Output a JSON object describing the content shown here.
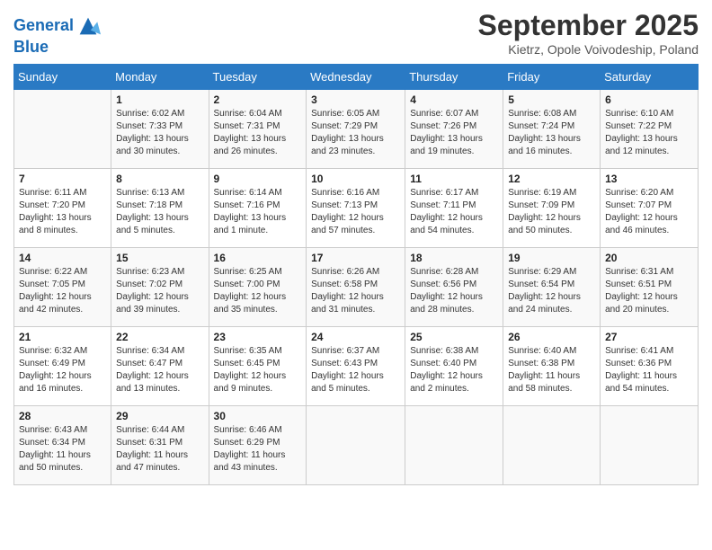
{
  "header": {
    "logo_line1": "General",
    "logo_line2": "Blue",
    "month": "September 2025",
    "location": "Kietrz, Opole Voivodeship, Poland"
  },
  "days_of_week": [
    "Sunday",
    "Monday",
    "Tuesday",
    "Wednesday",
    "Thursday",
    "Friday",
    "Saturday"
  ],
  "weeks": [
    [
      {
        "day": "",
        "sunrise": "",
        "sunset": "",
        "daylight": ""
      },
      {
        "day": "1",
        "sunrise": "Sunrise: 6:02 AM",
        "sunset": "Sunset: 7:33 PM",
        "daylight": "Daylight: 13 hours and 30 minutes."
      },
      {
        "day": "2",
        "sunrise": "Sunrise: 6:04 AM",
        "sunset": "Sunset: 7:31 PM",
        "daylight": "Daylight: 13 hours and 26 minutes."
      },
      {
        "day": "3",
        "sunrise": "Sunrise: 6:05 AM",
        "sunset": "Sunset: 7:29 PM",
        "daylight": "Daylight: 13 hours and 23 minutes."
      },
      {
        "day": "4",
        "sunrise": "Sunrise: 6:07 AM",
        "sunset": "Sunset: 7:26 PM",
        "daylight": "Daylight: 13 hours and 19 minutes."
      },
      {
        "day": "5",
        "sunrise": "Sunrise: 6:08 AM",
        "sunset": "Sunset: 7:24 PM",
        "daylight": "Daylight: 13 hours and 16 minutes."
      },
      {
        "day": "6",
        "sunrise": "Sunrise: 6:10 AM",
        "sunset": "Sunset: 7:22 PM",
        "daylight": "Daylight: 13 hours and 12 minutes."
      }
    ],
    [
      {
        "day": "7",
        "sunrise": "Sunrise: 6:11 AM",
        "sunset": "Sunset: 7:20 PM",
        "daylight": "Daylight: 13 hours and 8 minutes."
      },
      {
        "day": "8",
        "sunrise": "Sunrise: 6:13 AM",
        "sunset": "Sunset: 7:18 PM",
        "daylight": "Daylight: 13 hours and 5 minutes."
      },
      {
        "day": "9",
        "sunrise": "Sunrise: 6:14 AM",
        "sunset": "Sunset: 7:16 PM",
        "daylight": "Daylight: 13 hours and 1 minute."
      },
      {
        "day": "10",
        "sunrise": "Sunrise: 6:16 AM",
        "sunset": "Sunset: 7:13 PM",
        "daylight": "Daylight: 12 hours and 57 minutes."
      },
      {
        "day": "11",
        "sunrise": "Sunrise: 6:17 AM",
        "sunset": "Sunset: 7:11 PM",
        "daylight": "Daylight: 12 hours and 54 minutes."
      },
      {
        "day": "12",
        "sunrise": "Sunrise: 6:19 AM",
        "sunset": "Sunset: 7:09 PM",
        "daylight": "Daylight: 12 hours and 50 minutes."
      },
      {
        "day": "13",
        "sunrise": "Sunrise: 6:20 AM",
        "sunset": "Sunset: 7:07 PM",
        "daylight": "Daylight: 12 hours and 46 minutes."
      }
    ],
    [
      {
        "day": "14",
        "sunrise": "Sunrise: 6:22 AM",
        "sunset": "Sunset: 7:05 PM",
        "daylight": "Daylight: 12 hours and 42 minutes."
      },
      {
        "day": "15",
        "sunrise": "Sunrise: 6:23 AM",
        "sunset": "Sunset: 7:02 PM",
        "daylight": "Daylight: 12 hours and 39 minutes."
      },
      {
        "day": "16",
        "sunrise": "Sunrise: 6:25 AM",
        "sunset": "Sunset: 7:00 PM",
        "daylight": "Daylight: 12 hours and 35 minutes."
      },
      {
        "day": "17",
        "sunrise": "Sunrise: 6:26 AM",
        "sunset": "Sunset: 6:58 PM",
        "daylight": "Daylight: 12 hours and 31 minutes."
      },
      {
        "day": "18",
        "sunrise": "Sunrise: 6:28 AM",
        "sunset": "Sunset: 6:56 PM",
        "daylight": "Daylight: 12 hours and 28 minutes."
      },
      {
        "day": "19",
        "sunrise": "Sunrise: 6:29 AM",
        "sunset": "Sunset: 6:54 PM",
        "daylight": "Daylight: 12 hours and 24 minutes."
      },
      {
        "day": "20",
        "sunrise": "Sunrise: 6:31 AM",
        "sunset": "Sunset: 6:51 PM",
        "daylight": "Daylight: 12 hours and 20 minutes."
      }
    ],
    [
      {
        "day": "21",
        "sunrise": "Sunrise: 6:32 AM",
        "sunset": "Sunset: 6:49 PM",
        "daylight": "Daylight: 12 hours and 16 minutes."
      },
      {
        "day": "22",
        "sunrise": "Sunrise: 6:34 AM",
        "sunset": "Sunset: 6:47 PM",
        "daylight": "Daylight: 12 hours and 13 minutes."
      },
      {
        "day": "23",
        "sunrise": "Sunrise: 6:35 AM",
        "sunset": "Sunset: 6:45 PM",
        "daylight": "Daylight: 12 hours and 9 minutes."
      },
      {
        "day": "24",
        "sunrise": "Sunrise: 6:37 AM",
        "sunset": "Sunset: 6:43 PM",
        "daylight": "Daylight: 12 hours and 5 minutes."
      },
      {
        "day": "25",
        "sunrise": "Sunrise: 6:38 AM",
        "sunset": "Sunset: 6:40 PM",
        "daylight": "Daylight: 12 hours and 2 minutes."
      },
      {
        "day": "26",
        "sunrise": "Sunrise: 6:40 AM",
        "sunset": "Sunset: 6:38 PM",
        "daylight": "Daylight: 11 hours and 58 minutes."
      },
      {
        "day": "27",
        "sunrise": "Sunrise: 6:41 AM",
        "sunset": "Sunset: 6:36 PM",
        "daylight": "Daylight: 11 hours and 54 minutes."
      }
    ],
    [
      {
        "day": "28",
        "sunrise": "Sunrise: 6:43 AM",
        "sunset": "Sunset: 6:34 PM",
        "daylight": "Daylight: 11 hours and 50 minutes."
      },
      {
        "day": "29",
        "sunrise": "Sunrise: 6:44 AM",
        "sunset": "Sunset: 6:31 PM",
        "daylight": "Daylight: 11 hours and 47 minutes."
      },
      {
        "day": "30",
        "sunrise": "Sunrise: 6:46 AM",
        "sunset": "Sunset: 6:29 PM",
        "daylight": "Daylight: 11 hours and 43 minutes."
      },
      {
        "day": "",
        "sunrise": "",
        "sunset": "",
        "daylight": ""
      },
      {
        "day": "",
        "sunrise": "",
        "sunset": "",
        "daylight": ""
      },
      {
        "day": "",
        "sunrise": "",
        "sunset": "",
        "daylight": ""
      },
      {
        "day": "",
        "sunrise": "",
        "sunset": "",
        "daylight": ""
      }
    ]
  ]
}
